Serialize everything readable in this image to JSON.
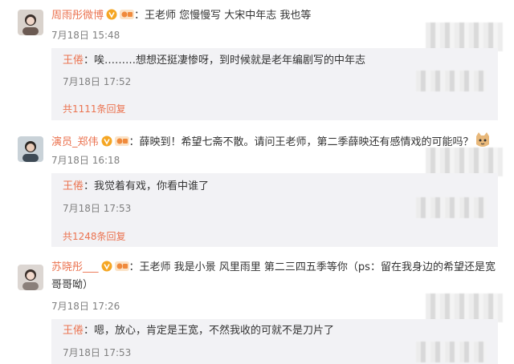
{
  "comments": [
    {
      "username": "周雨彤微博",
      "text": "：王老师 您慢慢写 大宋中年志 我也等",
      "time": "7月18日 15:48",
      "reply": {
        "author": "王倦",
        "text": "：唉………想想还挺凄惨呀，到时候就是老年编剧写的中年志",
        "time": "7月18日 17:52"
      },
      "more": "共1111条回复"
    },
    {
      "username": "演员_郑伟",
      "text": "：薛映到！希望七斋不散。请问王老师，第二季薛映还有感情戏的可能吗？",
      "time": "7月18日 16:18",
      "reply": {
        "author": "王倦",
        "text": "：我觉着有戏，你看中谁了",
        "time": "7月18日 17:53"
      },
      "more": "共1248条回复"
    },
    {
      "username": "苏晓彤___",
      "text": "：王老师 我是小景 风里雨里 第二三四五季等你（ps：留在我身边的希望还是宽哥哥呦）",
      "time": "7月18日 17:26",
      "reply": {
        "author": "王倦",
        "text": "：嗯，放心，肯定是王宽，不然我收的可就不是刀片了",
        "time": "7月18日 17:53"
      }
    }
  ],
  "colors": {
    "username": "#eb7350",
    "reply_bg": "#f2f2f5",
    "time": "#808080"
  },
  "icons": {
    "verified": "v-badge-icon",
    "fan": "fan-badge-icon",
    "emoji": "cat-emoji-icon"
  }
}
